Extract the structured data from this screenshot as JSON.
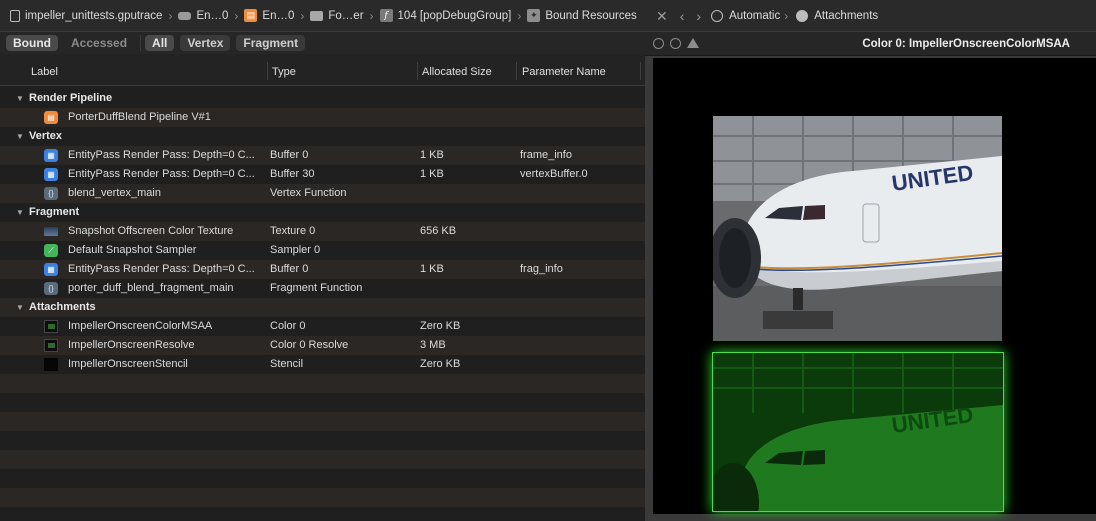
{
  "jumpbar": {
    "crumbs": [
      {
        "label": "impeller_unittests.gputrace",
        "icon": "document-icon"
      },
      {
        "label": "En…0",
        "icon": "drive-icon"
      },
      {
        "label": "En…0",
        "icon": "encoder-icon"
      },
      {
        "label": "Fo…er",
        "icon": "folder-icon"
      },
      {
        "label": "104 [popDebugGroup]",
        "icon": "function-icon"
      },
      {
        "label": "Bound Resources",
        "icon": "gear-icon"
      }
    ],
    "close_glyph": "✕",
    "back_glyph": "‹",
    "forward_glyph": "›",
    "automatic_label": "Automatic",
    "attachments_label": "Attachments"
  },
  "filters": {
    "bound": "Bound",
    "accessed": "Accessed",
    "all": "All",
    "vertex": "Vertex",
    "fragment": "Fragment"
  },
  "columns": {
    "label": "Label",
    "type": "Type",
    "size": "Allocated Size",
    "param": "Parameter Name"
  },
  "groups": {
    "render_pipeline": "Render Pipeline",
    "vertex": "Vertex",
    "fragment": "Fragment",
    "attachments": "Attachments"
  },
  "rows": {
    "pipeline": {
      "label": "PorterDuffBlend Pipeline V#1"
    },
    "v1": {
      "label": "EntityPass Render Pass: Depth=0 C...",
      "type": "Buffer 0",
      "size": "1 KB",
      "param": "frame_info"
    },
    "v2": {
      "label": "EntityPass Render Pass: Depth=0 C...",
      "type": "Buffer 30",
      "size": "1 KB",
      "param": "vertexBuffer.0"
    },
    "v3": {
      "label": "blend_vertex_main",
      "type": "Vertex Function"
    },
    "f1": {
      "label": "Snapshot Offscreen Color Texture",
      "type": "Texture 0",
      "size": "656 KB"
    },
    "f2": {
      "label": "Default Snapshot Sampler",
      "type": "Sampler 0"
    },
    "f3": {
      "label": "EntityPass Render Pass: Depth=0 C...",
      "type": "Buffer 0",
      "size": "1 KB",
      "param": "frag_info"
    },
    "f4": {
      "label": "porter_duff_blend_fragment_main",
      "type": "Fragment Function"
    },
    "a1": {
      "label": "ImpellerOnscreenColorMSAA",
      "type": "Color 0",
      "size": "Zero KB"
    },
    "a2": {
      "label": "ImpellerOnscreenResolve",
      "type": "Color 0 Resolve",
      "size": "3 MB"
    },
    "a3": {
      "label": "ImpellerOnscreenStencil",
      "type": "Stencil",
      "size": "Zero KB"
    }
  },
  "preview": {
    "title": "Color 0: ImpellerOnscreenColorMSAA",
    "airline_text": "UNITED"
  },
  "colors": {
    "accent_orange": "#f08a3c",
    "buffer_blue": "#3b82e0",
    "sampler_green": "#43b55a",
    "preview_green": "#2bd12b"
  }
}
